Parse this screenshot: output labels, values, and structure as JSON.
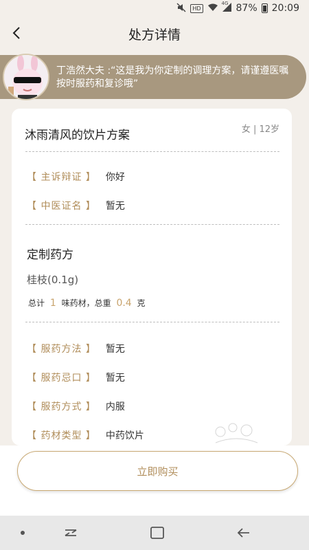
{
  "status_bar": {
    "hd_label": "HD",
    "network": "4G",
    "battery": "87%",
    "time": "20:09"
  },
  "header": {
    "title": "处方详情"
  },
  "doctor": {
    "message": "丁浩然大夫 :“这是我为你定制的调理方案，请谨遵医嘱按时服药和复诊哦”"
  },
  "plan": {
    "title": "沐雨清风的饮片方案",
    "patient": "女 | 12岁",
    "complaint_label": "【 主诉辩证 】",
    "complaint_value": "你好",
    "diagnosis_label": "【 中医证名 】",
    "diagnosis_value": "暂无"
  },
  "prescription": {
    "section_title": "定制药方",
    "herb": "桂枝(0.1g)",
    "total_prefix": "总计",
    "total_count": "1",
    "total_mid": "味药材，总重",
    "total_weight": "0.4",
    "total_unit": "克"
  },
  "usage": {
    "method_label": "【 服药方法 】",
    "method_value": "暂无",
    "taboo_label": "【 服药忌口 】",
    "taboo_value": "暂无",
    "mode_label": "【 服药方式 】",
    "mode_value": "内服",
    "type_label": "【 药材类型 】",
    "type_value": "中药饮片"
  },
  "actions": {
    "buy_label": "立即购买"
  },
  "colors": {
    "accent": "#b08d5a",
    "banner": "#a8987f",
    "background": "#f3efea"
  }
}
